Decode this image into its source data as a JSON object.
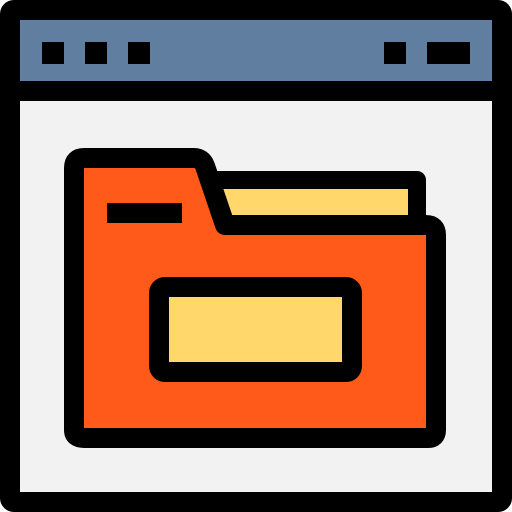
{
  "icon": {
    "name": "browser-folder-icon",
    "colors": {
      "outline": "#000000",
      "titlebar": "#607EA0",
      "window_body": "#F2F2F2",
      "folder": "#FF5A1A",
      "folder_paper": "#FFD76A",
      "label": "#FFD76A"
    }
  }
}
